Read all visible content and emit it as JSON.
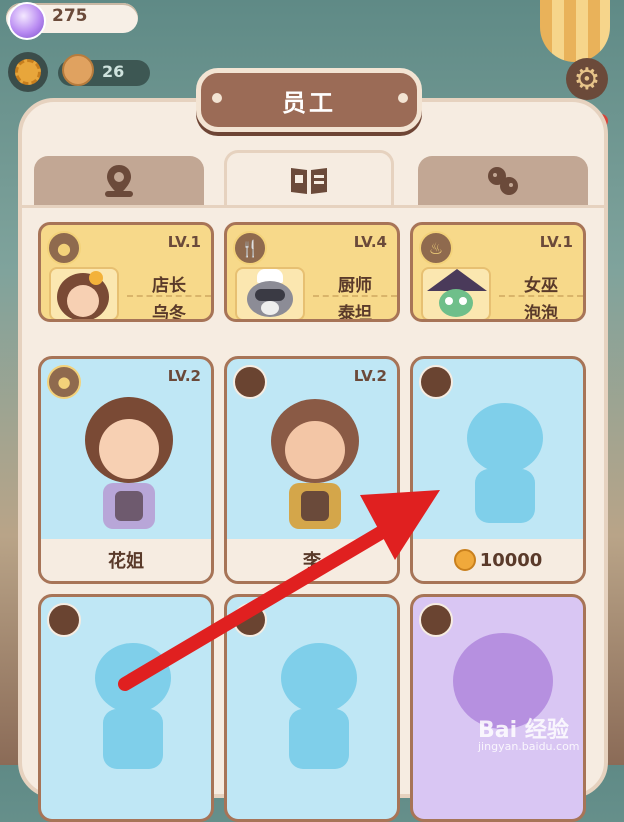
{
  "hud": {
    "gems": "275",
    "staff_count": "26"
  },
  "panel": {
    "title": "员工"
  },
  "tabs": [
    {
      "name": "map-pin-icon"
    },
    {
      "name": "book-icon"
    },
    {
      "name": "cookies-icon"
    }
  ],
  "managers": [
    {
      "level": "LV.1",
      "role": "店长",
      "name": "乌冬",
      "badge_icon": "cookie-icon"
    },
    {
      "level": "LV.4",
      "role": "厨师",
      "name": "泰坦",
      "badge_icon": "utensils-icon"
    },
    {
      "level": "LV.1",
      "role": "女巫",
      "name": "泡泡",
      "badge_icon": "cauldron-icon"
    }
  ],
  "staff": [
    {
      "level": "LV.2",
      "label": "花姐"
    },
    {
      "level": "LV.2",
      "label": "李"
    },
    {
      "price": "10000"
    }
  ],
  "watermark": {
    "brand": "Bai 经验",
    "url": "jingyan.baidu.com"
  },
  "colors": {
    "card_yellow": "#f7d98a",
    "card_blue": "#bfe7f5",
    "card_purple": "#d9c6f3",
    "arrow_red": "#e02020"
  }
}
